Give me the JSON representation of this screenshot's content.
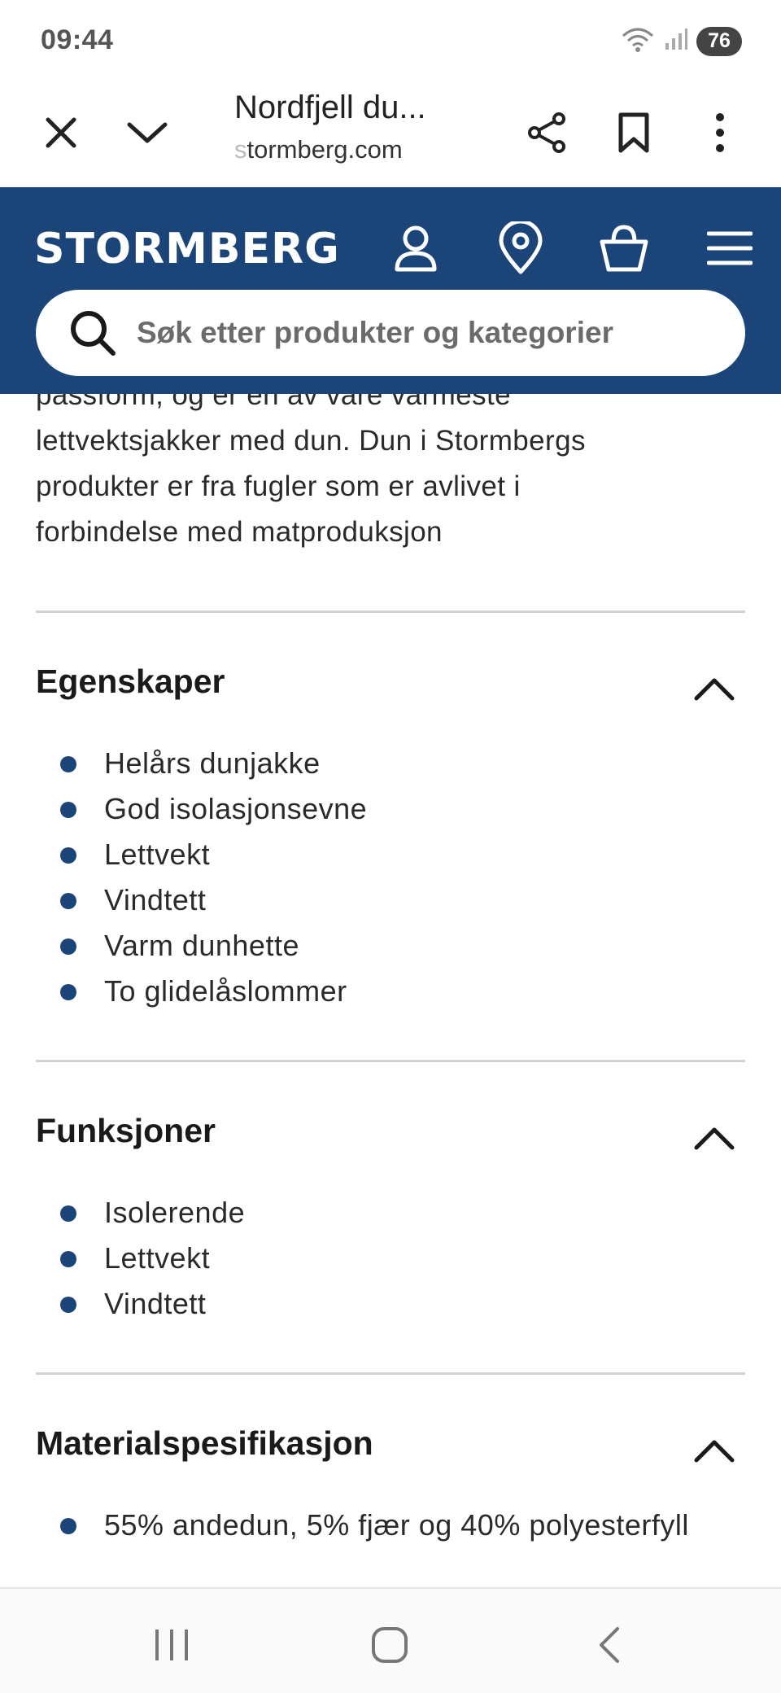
{
  "status_bar": {
    "time": "09:44",
    "battery": "76",
    "icons": [
      "wifi-icon",
      "signal-icon"
    ]
  },
  "browser": {
    "title": "Nordfjell du...",
    "url_prefix": "s",
    "url": "tormberg.com",
    "icons": [
      "close-icon",
      "chevron-down-icon",
      "share-icon",
      "bookmark-icon",
      "more-vert-icon"
    ]
  },
  "site": {
    "logo_text": "STORMBERG",
    "header_icons": [
      "user-icon",
      "location-pin-icon",
      "basket-icon",
      "menu-icon"
    ],
    "search_placeholder": "Søk etter produkter og kategorier",
    "brand_color": "#1b4579"
  },
  "content": {
    "intro_lines": [
      "passform, og er en av våre varmeste",
      "lettvektsjakker med dun. Dun i Stormbergs",
      "produkter er fra fugler som er avlivet i",
      "forbindelse med matproduksjon"
    ],
    "sections": [
      {
        "title": "Egenskaper",
        "expanded": true,
        "items": [
          "Helårs dunjakke",
          "God isolasjonsevne",
          "Lettvekt",
          "Vindtett",
          "Varm dunhette",
          "To glidelåslommer"
        ]
      },
      {
        "title": "Funksjoner",
        "expanded": true,
        "items": [
          "Isolerende",
          "Lettvekt",
          "Vindtett"
        ]
      },
      {
        "title": "Materialspesifikasjon",
        "expanded": true,
        "items": [
          "55% andedun, 5% fjær og 40% polyesterfyll"
        ]
      }
    ]
  },
  "nav_bar": {
    "icons": [
      "recent-apps-icon",
      "home-icon",
      "back-icon"
    ]
  }
}
